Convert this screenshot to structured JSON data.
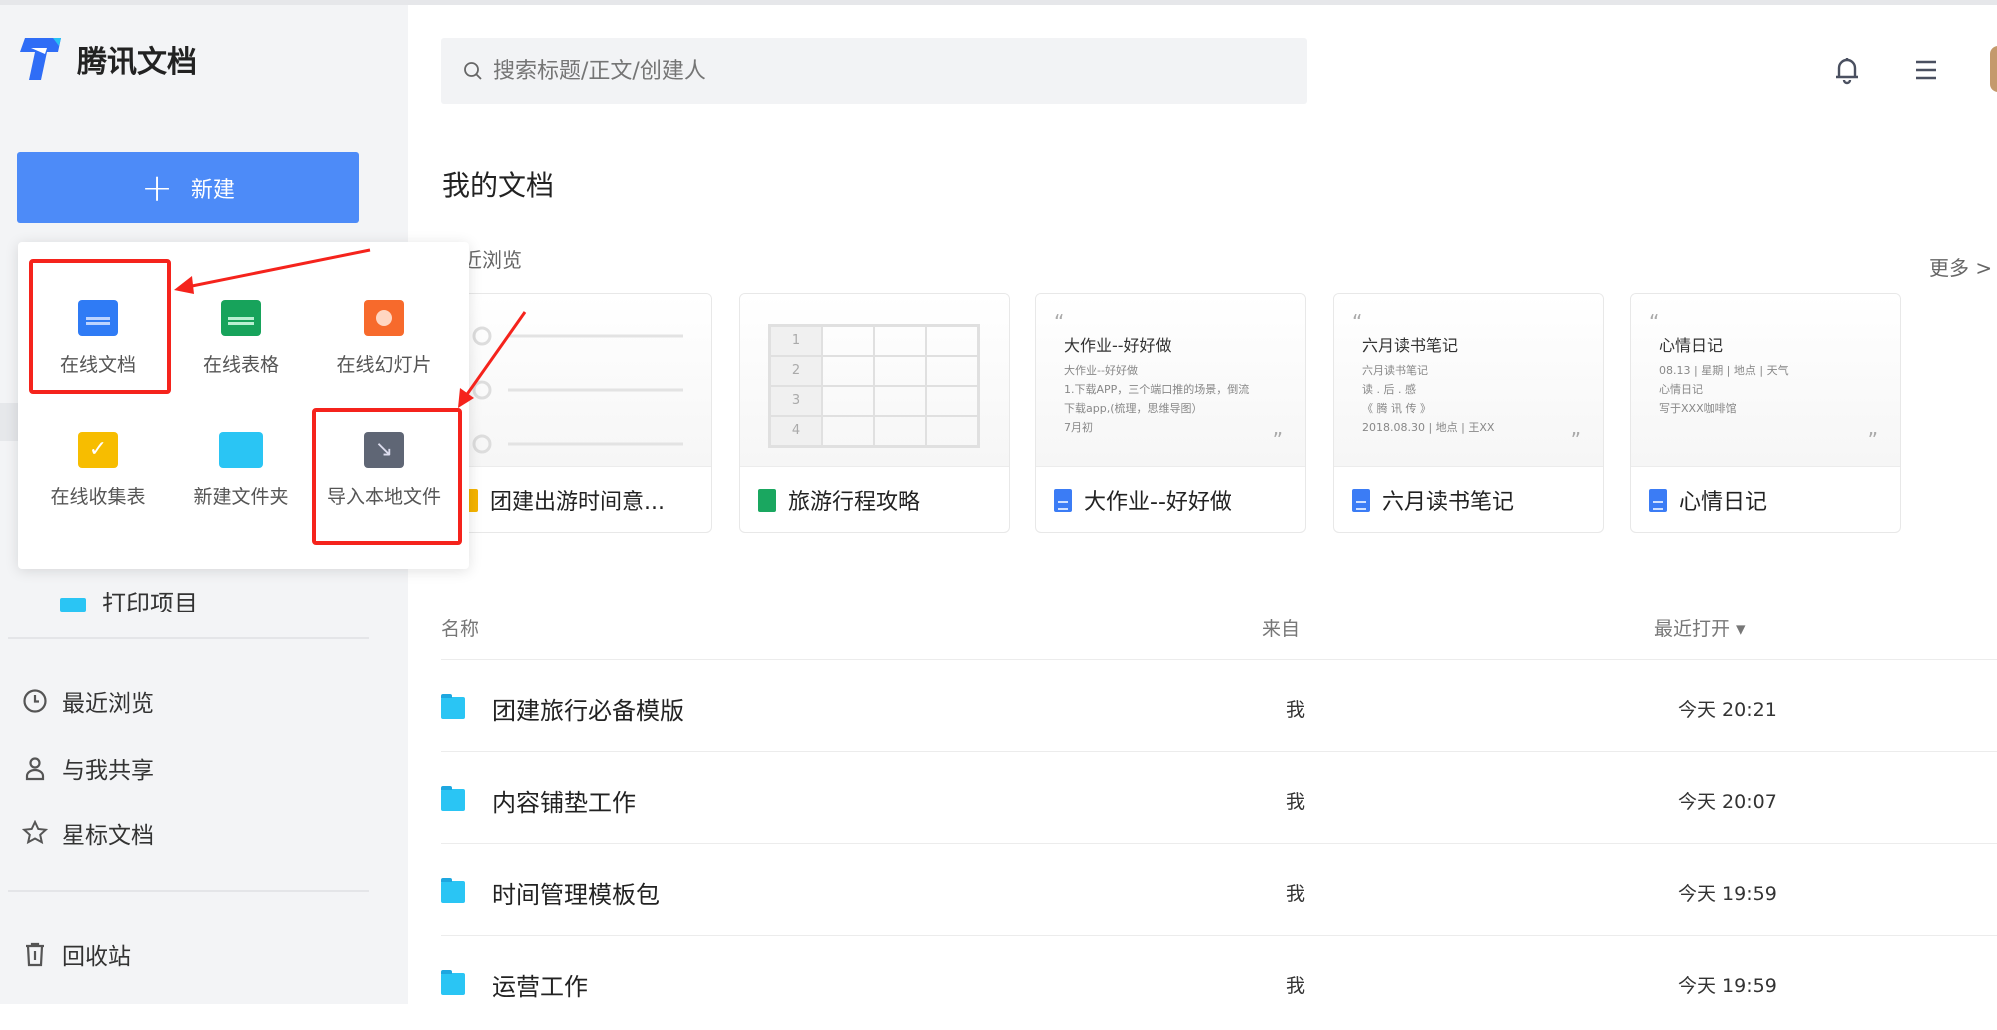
{
  "app": {
    "name": "腾讯文档"
  },
  "sidebar": {
    "new_button": "新建",
    "hidden_folder": "打印项目",
    "nav": [
      {
        "label": "最近浏览",
        "icon": "clock-icon"
      },
      {
        "label": "与我共享",
        "icon": "person-icon"
      },
      {
        "label": "星标文档",
        "icon": "star-icon"
      }
    ],
    "trash": "回收站"
  },
  "new_menu": {
    "items": [
      {
        "label": "在线文档",
        "icon": "doc-icon",
        "color": "#2f7bf5"
      },
      {
        "label": "在线表格",
        "icon": "sheet-icon",
        "color": "#17a35b"
      },
      {
        "label": "在线幻灯片",
        "icon": "slide-icon",
        "color": "#f76a2c"
      },
      {
        "label": "在线收集表",
        "icon": "form-icon",
        "color": "#f7bd00"
      },
      {
        "label": "新建文件夹",
        "icon": "folder-icon",
        "color": "#2ac5f4"
      },
      {
        "label": "导入本地文件",
        "icon": "import-icon",
        "color": "#5f6675"
      }
    ]
  },
  "header": {
    "search_placeholder": "搜索标题/正文/创建人"
  },
  "main": {
    "title": "我的文档",
    "recent_label": "最近浏览",
    "more_label": "更多 >",
    "cards": [
      {
        "title": "团建出游时间意...",
        "type": "form"
      },
      {
        "title": "旅游行程攻略",
        "type": "sheet",
        "rows": [
          "1",
          "2",
          "3",
          "4"
        ]
      },
      {
        "title": "大作业--好好做",
        "type": "doc",
        "preview_title": "大作业--好好做",
        "lines": [
          "大作业--好好做",
          "1.下载APP，三个端口推的场景，倒流",
          "下载app,(梳理，思维导图）",
          "7月初"
        ]
      },
      {
        "title": "六月读书笔记",
        "type": "doc",
        "preview_title": "六月读书笔记",
        "lines": [
          "六月读书笔记",
          "读 . 后 . 感",
          "《 腾 讯 传 》",
          "2018.08.30 | 地点 | 王XX"
        ]
      },
      {
        "title": "心情日记",
        "type": "doc",
        "preview_title": "心情日记",
        "lines": [
          "08.13 | 星期 | 地点 | 天气",
          "心情日记",
          "写于XXX咖啡馆"
        ]
      }
    ],
    "columns": {
      "name": "名称",
      "from": "来自",
      "opened": "最近打开 ▾"
    },
    "rows": [
      {
        "name": "团建旅行必备模版",
        "from": "我",
        "opened": "今天 20:21"
      },
      {
        "name": "内容铺垫工作",
        "from": "我",
        "opened": "今天 20:07"
      },
      {
        "name": "时间管理模板包",
        "from": "我",
        "opened": "今天 19:59"
      },
      {
        "name": "运营工作",
        "from": "我",
        "opened": "今天 19:59"
      }
    ]
  }
}
